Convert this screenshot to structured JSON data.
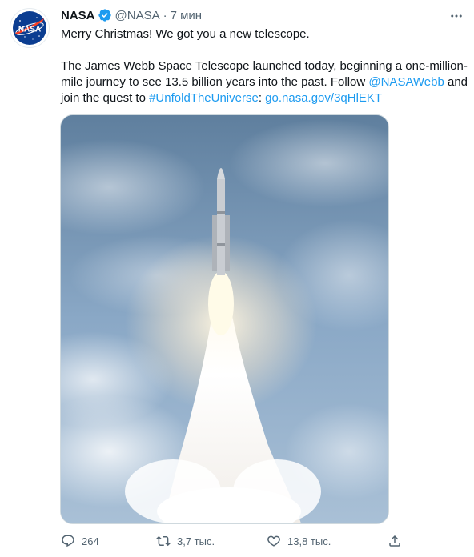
{
  "author": {
    "name": "NASA",
    "handle": "@NASA",
    "separator": "·",
    "time": "7 мин",
    "avatar_text": "NASA",
    "verified_icon": "verified-badge-icon"
  },
  "tweet": {
    "line1": "Merry Christmas! We got you a new telescope.",
    "body_prefix": "The James Webb Space Telescope launched today, beginning a one-million-mile journey to see 13.5 billion years into the past. Follow ",
    "mention": "@NASAWebb",
    "body_middle": " and join the quest to ",
    "hashtag": "#UnfoldTheUniverse",
    "colon": ": ",
    "url": "go.nasa.gov/3qHlEKT"
  },
  "actions": {
    "replies": "264",
    "retweets": "3,7 тыс.",
    "likes": "13,8 тыс."
  },
  "colors": {
    "link": "#1d9bf0",
    "secondary_text": "#536471",
    "nasa_blue": "#0b3d91",
    "nasa_red": "#fc3d21"
  }
}
